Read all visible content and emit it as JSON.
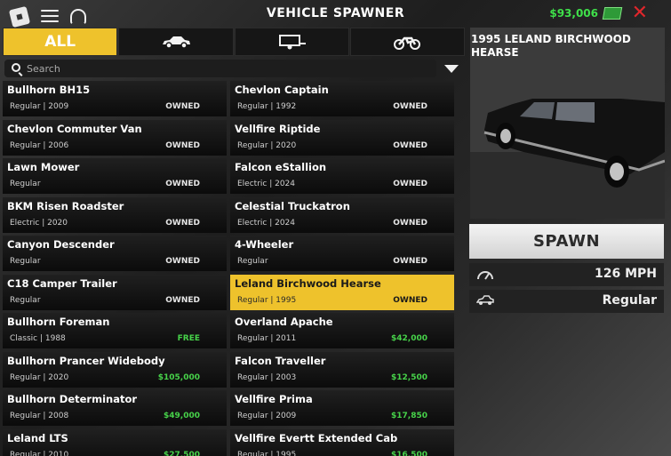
{
  "header": {
    "title": "VEHICLE SPAWNER",
    "money": "$93,006"
  },
  "tabs": [
    {
      "label": "ALL",
      "icon": "all"
    },
    {
      "label": "",
      "icon": "car-icon"
    },
    {
      "label": "",
      "icon": "trailer-icon"
    },
    {
      "label": "",
      "icon": "motorcycle-icon"
    }
  ],
  "search": {
    "placeholder": "Search"
  },
  "vehicles": [
    {
      "name": "Bullhorn BH15",
      "meta": "Regular | 2009",
      "status": "OWNED"
    },
    {
      "name": "Chevlon Captain",
      "meta": "Regular | 1992",
      "status": "OWNED"
    },
    {
      "name": "Chevlon Commuter Van",
      "meta": "Regular | 2006",
      "status": "OWNED"
    },
    {
      "name": "Vellfire Riptide",
      "meta": "Regular | 2020",
      "status": "OWNED"
    },
    {
      "name": "Lawn Mower",
      "meta": "Regular",
      "status": "OWNED"
    },
    {
      "name": "Falcon eStallion",
      "meta": "Electric | 2024",
      "status": "OWNED"
    },
    {
      "name": "BKM Risen Roadster",
      "meta": "Electric | 2020",
      "status": "OWNED"
    },
    {
      "name": "Celestial Truckatron",
      "meta": "Electric | 2024",
      "status": "OWNED"
    },
    {
      "name": "Canyon Descender",
      "meta": "Regular",
      "status": "OWNED"
    },
    {
      "name": "4-Wheeler",
      "meta": "Regular",
      "status": "OWNED"
    },
    {
      "name": "C18 Camper Trailer",
      "meta": "Regular",
      "status": "OWNED"
    },
    {
      "name": "Leland Birchwood Hearse",
      "meta": "Regular | 1995",
      "status": "OWNED",
      "selected": true
    },
    {
      "name": "Bullhorn Foreman",
      "meta": "Classic | 1988",
      "status": "FREE"
    },
    {
      "name": "Overland Apache",
      "meta": "Regular | 2011",
      "status": "$42,000"
    },
    {
      "name": "Bullhorn Prancer Widebody",
      "meta": "Regular | 2020",
      "status": "$105,000"
    },
    {
      "name": "Falcon Traveller",
      "meta": "Regular | 2003",
      "status": "$12,500"
    },
    {
      "name": "Bullhorn Determinator",
      "meta": "Regular | 2008",
      "status": "$49,000"
    },
    {
      "name": "Vellfire Prima",
      "meta": "Regular | 2009",
      "status": "$17,850"
    },
    {
      "name": "Leland LTS",
      "meta": "Regular | 2010",
      "status": "$27,500"
    },
    {
      "name": "Vellfire Evertt Extended Cab",
      "meta": "Regular | 1995",
      "status": "$16,500"
    }
  ],
  "selected_vehicle": {
    "title": "1995 LELAND BIRCHWOOD HEARSE",
    "spawn_label": "SPAWN",
    "speed": "126 MPH",
    "class": "Regular"
  },
  "colors": {
    "accent": "#eec22c",
    "money_green": "#3fe04a",
    "close_red": "#e0262b"
  }
}
